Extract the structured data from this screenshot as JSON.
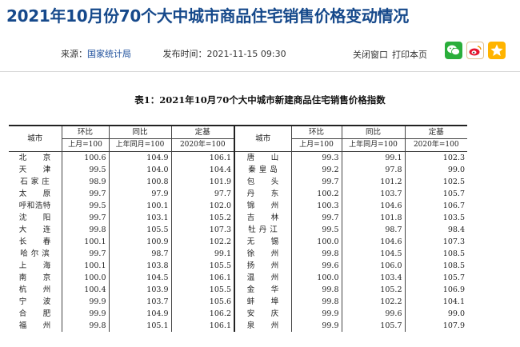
{
  "page": {
    "title": "2021年10月份70个大中城市商品住宅销售价格变动情况",
    "source_label": "来源：",
    "source_name": "国家统计局",
    "published_label": "发布时间：",
    "published_time": "2021-11-15   09:30",
    "close_window": "关闭窗口",
    "print_page": "打印本页"
  },
  "icons": {
    "share_wechat": "wechat-icon",
    "share_weibo": "weibo-icon",
    "favorite": "star-icon",
    "colors": {
      "wechat": "#2aae3b",
      "weibo": "#e6162d",
      "star": "#ffb400",
      "title": "#16498b"
    }
  },
  "table": {
    "title": "表1：2021年10月70个大中城市新建商品住宅销售价格指数",
    "headers": {
      "city": "城市",
      "mom": "环比",
      "yoy": "同比",
      "base": "定基",
      "mom_sub": "上月=100",
      "yoy_sub": "上年同月=100",
      "base_sub": "2020年=100"
    },
    "rows": [
      {
        "l": [
          "北　　京",
          "100.6",
          "104.9",
          "106.1"
        ],
        "r": [
          "唐　　山",
          "99.3",
          "99.1",
          "102.3"
        ]
      },
      {
        "l": [
          "天　　津",
          "99.5",
          "104.0",
          "104.4"
        ],
        "r": [
          "秦 皇 岛",
          "99.2",
          "97.8",
          "99.0"
        ]
      },
      {
        "l": [
          "石 家 庄",
          "98.9",
          "100.8",
          "101.9"
        ],
        "r": [
          "包　　头",
          "99.7",
          "101.2",
          "102.5"
        ]
      },
      {
        "l": [
          "太　　原",
          "99.7",
          "97.9",
          "97.7"
        ],
        "r": [
          "丹　　东",
          "100.2",
          "103.7",
          "105.7"
        ]
      },
      {
        "l": [
          "呼和浩特",
          "99.5",
          "100.1",
          "102.0"
        ],
        "r": [
          "锦　　州",
          "100.3",
          "104.6",
          "106.7"
        ]
      },
      {
        "l": [
          "沈　　阳",
          "99.7",
          "103.1",
          "105.2"
        ],
        "r": [
          "吉　　林",
          "99.7",
          "101.8",
          "103.5"
        ]
      },
      {
        "l": [
          "大　　连",
          "99.8",
          "105.5",
          "107.3"
        ],
        "r": [
          "牡 丹 江",
          "99.5",
          "98.7",
          "98.4"
        ]
      },
      {
        "l": [
          "长　　春",
          "100.1",
          "100.9",
          "102.2"
        ],
        "r": [
          "无　　锡",
          "100.0",
          "104.6",
          "107.3"
        ]
      },
      {
        "l": [
          "哈 尔 滨",
          "99.7",
          "98.7",
          "99.1"
        ],
        "r": [
          "徐　　州",
          "99.8",
          "104.5",
          "108.5"
        ]
      },
      {
        "l": [
          "上　　海",
          "100.1",
          "103.8",
          "105.5"
        ],
        "r": [
          "扬　　州",
          "99.6",
          "106.0",
          "108.5"
        ]
      },
      {
        "l": [
          "南　　京",
          "100.0",
          "104.5",
          "106.1"
        ],
        "r": [
          "温　　州",
          "100.0",
          "103.4",
          "105.7"
        ]
      },
      {
        "l": [
          "杭　　州",
          "100.4",
          "103.9",
          "105.5"
        ],
        "r": [
          "金　　华",
          "99.8",
          "105.2",
          "106.9"
        ]
      },
      {
        "l": [
          "宁　　波",
          "99.9",
          "103.7",
          "105.6"
        ],
        "r": [
          "蚌　　埠",
          "99.8",
          "102.2",
          "104.1"
        ]
      },
      {
        "l": [
          "合　　肥",
          "99.9",
          "104.9",
          "106.2"
        ],
        "r": [
          "安　　庆",
          "99.9",
          "99.6",
          "99.0"
        ]
      },
      {
        "l": [
          "福　　州",
          "99.8",
          "105.1",
          "106.1"
        ],
        "r": [
          "泉　　州",
          "99.9",
          "105.7",
          "107.9"
        ]
      }
    ]
  }
}
